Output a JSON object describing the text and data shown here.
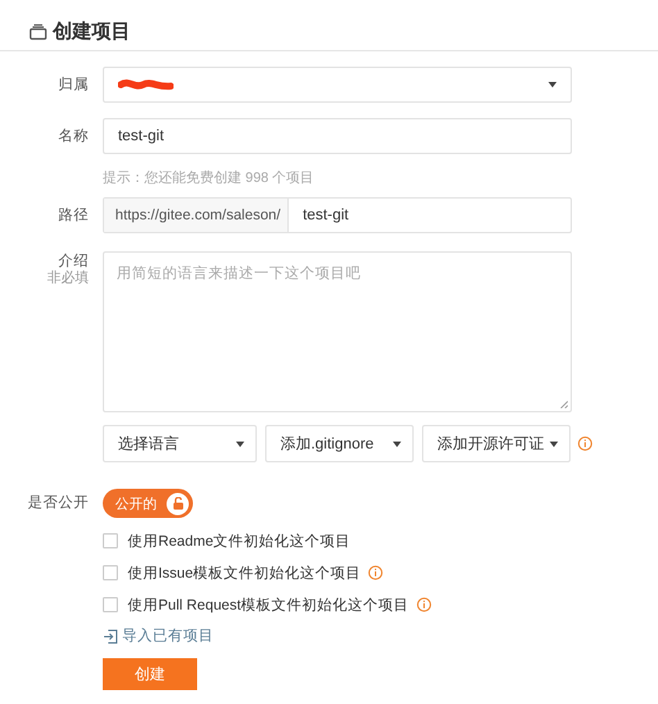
{
  "header": {
    "title": "创建项目"
  },
  "owner": {
    "label": "归属",
    "redacted": true
  },
  "name": {
    "label": "名称",
    "value": "test-git"
  },
  "hint": "提示：您还能免费创建 998 个项目",
  "path": {
    "label": "路径",
    "prefix": "https://gitee.com/saleson/",
    "value": "test-git"
  },
  "description": {
    "label": "介绍",
    "sublabel": "非必填",
    "placeholder": "用简短的语言来描述一下这个项目吧"
  },
  "dropdowns": [
    {
      "label": "选择语言",
      "info": false
    },
    {
      "label": "添加.gitignore",
      "info": false
    },
    {
      "label": "添加开源许可证",
      "info": true
    }
  ],
  "visibility": {
    "label": "是否公开",
    "toggle_label": "公开的",
    "on": true
  },
  "options": [
    {
      "label": "使用Readme文件初始化这个项目",
      "checked": false,
      "info": false
    },
    {
      "label": "使用Issue模板文件初始化这个项目",
      "checked": false,
      "info": true
    },
    {
      "label": "使用Pull Request模板文件初始化这个项目",
      "checked": false,
      "info": true
    }
  ],
  "import_link": "导入已有项目",
  "submit": "创建"
}
